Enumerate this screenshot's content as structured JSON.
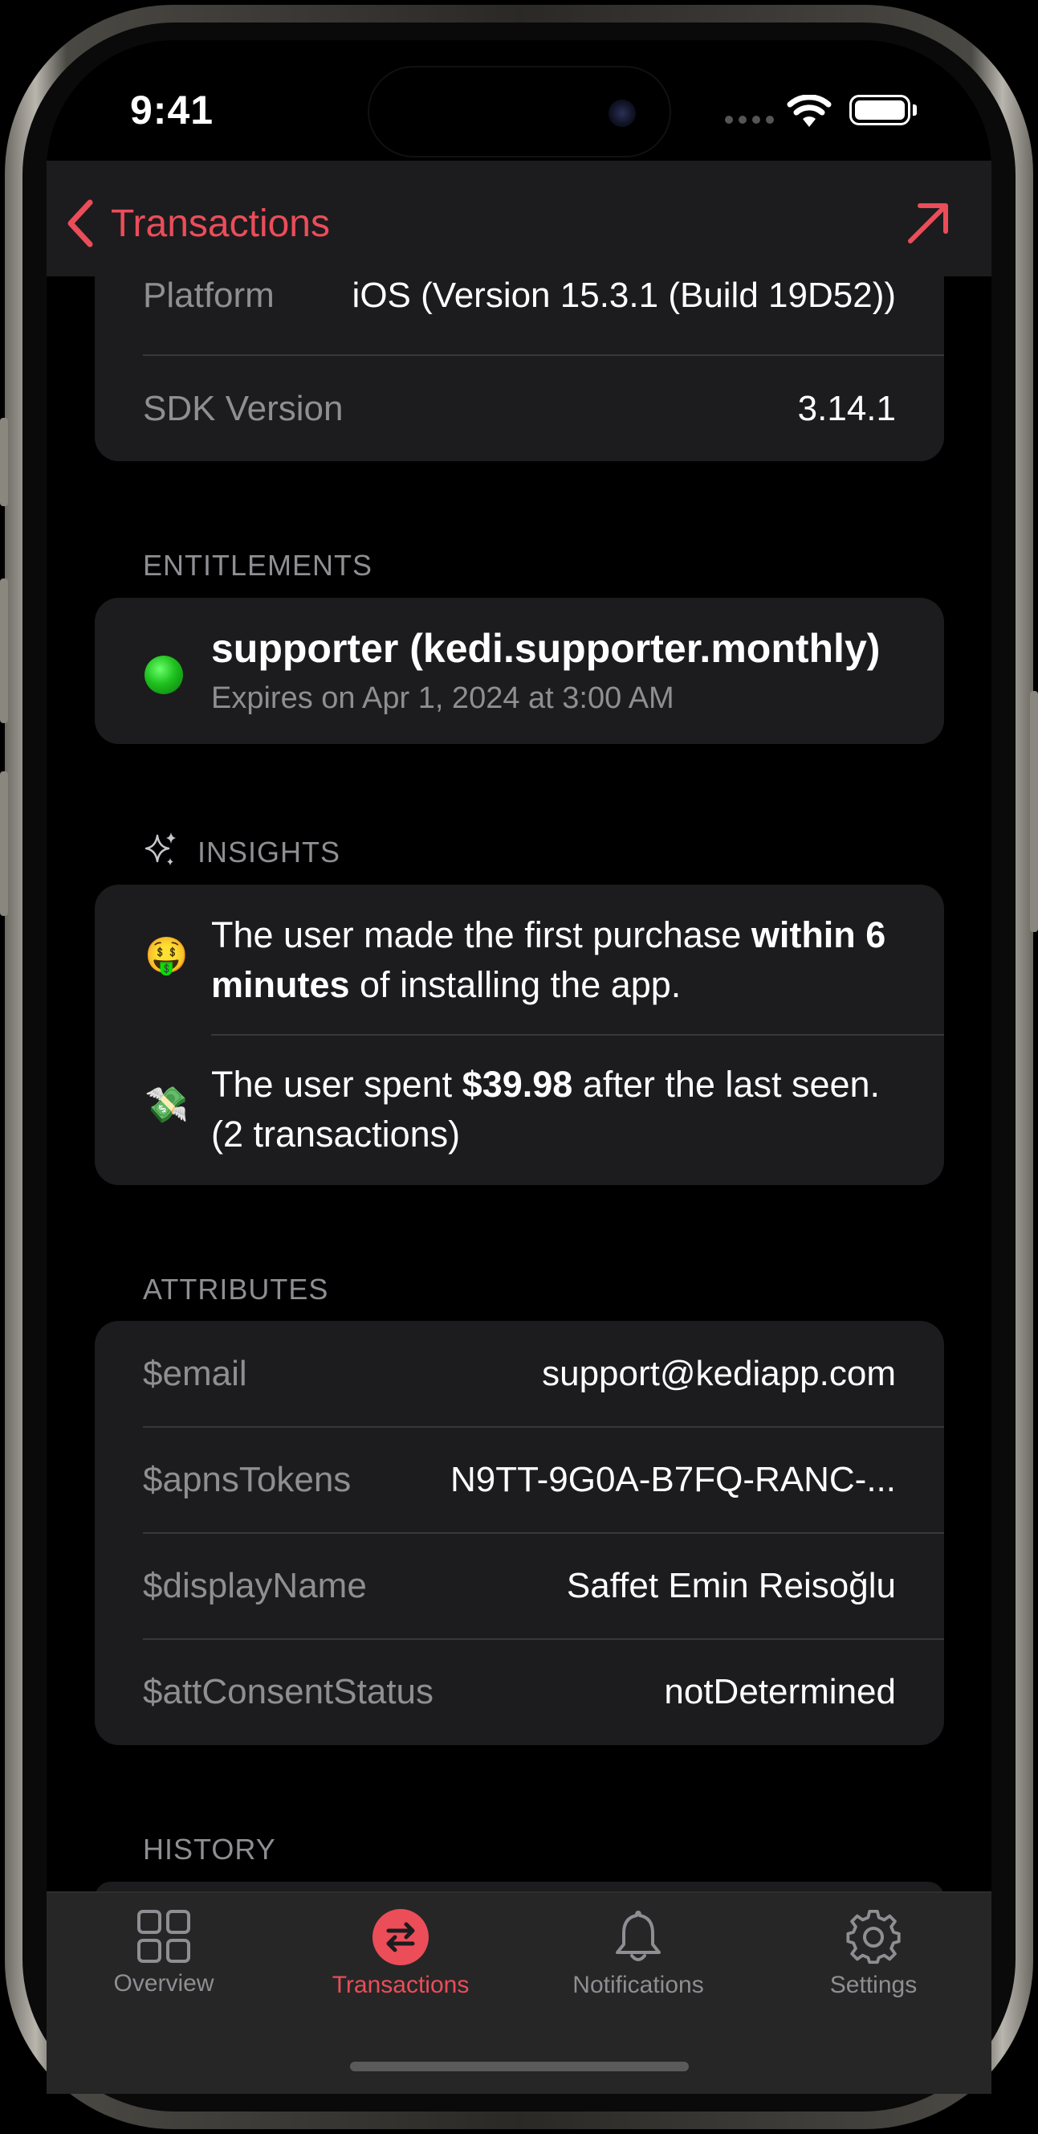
{
  "status_bar": {
    "time": "9:41"
  },
  "nav": {
    "back_label": "Transactions"
  },
  "device_info": {
    "rows": [
      {
        "key": "Platform",
        "value": "iOS (Version 15.3.1 (Build 19D52))"
      },
      {
        "key": "SDK Version",
        "value": "3.14.1"
      }
    ]
  },
  "entitlements": {
    "header": "ENTITLEMENTS",
    "items": [
      {
        "title": "supporter (kedi.supporter.monthly)",
        "subtitle": "Expires on Apr 1, 2024 at 3:00 AM",
        "status_color": "#22c322"
      }
    ]
  },
  "insights": {
    "header": "INSIGHTS",
    "items": [
      {
        "emoji": "🤑",
        "pre": "The user made the first purchase ",
        "bold": "within 6 minutes",
        "post": " of installing the app."
      },
      {
        "emoji": "💸",
        "pre": "The user spent ",
        "bold": "$39.98",
        "post": " after the last seen. (2 transactions)"
      }
    ]
  },
  "attributes": {
    "header": "ATTRIBUTES",
    "rows": [
      {
        "key": "$email",
        "value": "support@kediapp.com"
      },
      {
        "key": "$apnsTokens",
        "value": "N9TT-9G0A-B7FQ-RANC-..."
      },
      {
        "key": "$displayName",
        "value": "Saffet Emin Reisoğlu"
      },
      {
        "key": "$attConsentStatus",
        "value": "notDetermined"
      }
    ]
  },
  "history": {
    "header": "HISTORY"
  },
  "tabbar": {
    "tabs": [
      {
        "label": "Overview",
        "icon": "grid-icon",
        "active": false
      },
      {
        "label": "Transactions",
        "icon": "arrows-swap-icon",
        "active": true
      },
      {
        "label": "Notifications",
        "icon": "bell-icon",
        "active": false
      },
      {
        "label": "Settings",
        "icon": "gear-icon",
        "active": false
      }
    ]
  },
  "colors": {
    "accent": "#eb4d59",
    "card": "#1c1c1e",
    "secondary_text": "#8e8e93"
  }
}
